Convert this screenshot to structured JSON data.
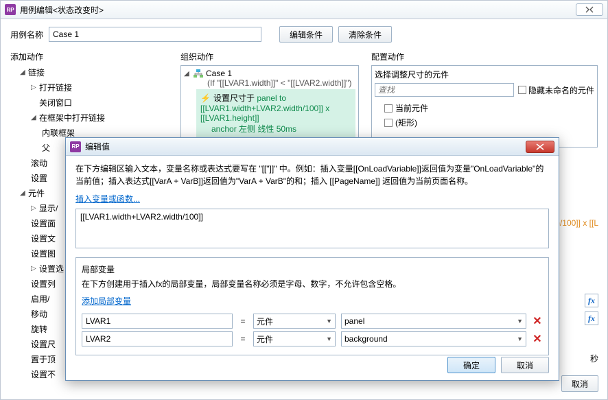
{
  "window": {
    "title": "用例编辑<状态改变时>"
  },
  "nameRow": {
    "label": "用例名称",
    "value": "Case 1",
    "btnEdit": "编辑条件",
    "btnClear": "清除条件"
  },
  "cols": {
    "left": "添加动作",
    "mid": "组织动作",
    "right": "配置动作"
  },
  "leftTree": {
    "grpLink": "链接",
    "openLink": "打开链接",
    "closeWin": "关闭窗口",
    "openInFrame": "在框架中打开链接",
    "inlineFrame": "内联框架",
    "parent": "父",
    "scroll": "滚动",
    "setVar": "设置",
    "grpElem": "元件",
    "show": "显示/",
    "setPanel": "设置面",
    "setText": "设置文",
    "setImg": "设置图",
    "setSel": "设置选",
    "setList": "设置列",
    "enable": "启用/",
    "move": "移动",
    "rotate": "旋转",
    "setSize": "设置尺",
    "bring": "置于顶",
    "setOpacity": "设置不"
  },
  "midCase": {
    "name": "Case 1",
    "cond": "(If \"[[LVAR1.width]]\" < \"[[LVAR2.width]]\")",
    "actTitle": "设置尺寸于",
    "actBody1": "panel to [[LVAR1.width+LVAR2.width/100]] x [[LVAR1.height]]",
    "actBody2": "anchor 左侧 线性 50ms"
  },
  "rightCfg": {
    "head": "选择调整尺寸的元件",
    "searchPlaceholder": "查找",
    "hideUnnamed": "隐藏未命名的元件",
    "optCurrent": "当前元件",
    "optRect": "(矩形)"
  },
  "modal": {
    "title": "编辑值",
    "desc": "在下方编辑区输入文本，变量名称或表达式要写在 \"[[\"]]\" 中。例如：插入变量[[OnLoadVariable]]返回值为变量\"OnLoadVariable\"的当前值；插入表达式[[VarA + VarB]]返回值为\"VarA + VarB\"的和；插入 [[PageName]] 返回值为当前页面名称。",
    "insertLink": "插入变量或函数...",
    "expr": "[[LVAR1.width+LVAR2.width/100]]",
    "lvHead": "局部变量",
    "lvDesc": "在下方创建用于插入fx的局部变量，局部变量名称必须是字母、数字，不允许包含空格。",
    "addLv": "添加局部变量",
    "r1name": "LVAR1",
    "r1type": "元件",
    "r1target": "panel",
    "r2name": "LVAR2",
    "r2type": "元件",
    "r2target": "background",
    "ok": "确定",
    "cancel": "取消"
  },
  "behind": {
    "orangePeek": "h/100]] x [[L",
    "sec": "秒",
    "cancel": "取消"
  }
}
